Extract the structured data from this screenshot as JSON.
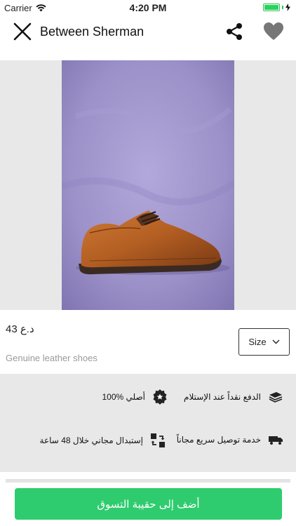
{
  "status_bar": {
    "carrier": "Carrier",
    "time": "4:20 PM"
  },
  "nav": {
    "title": "Between Sherman",
    "icons": [
      "close-icon",
      "share-icon",
      "heart-icon"
    ]
  },
  "product": {
    "price": "43 د.ع",
    "size_label": "Size",
    "description": "Genuine leather shoes"
  },
  "features": {
    "cash_on_delivery": "الدفع نقداً عند الإستلام",
    "original": "100% أصلي",
    "fast_delivery": "خدمة توصيل سريع مجاناً",
    "free_exchange": "إستبدال مجاني خلال 48 ساعة"
  },
  "actions": {
    "add_to_bag": "أضف إلى حقيبة التسوق"
  },
  "colors": {
    "accent_green": "#2fcc6f",
    "battery_green": "#2bd25c",
    "image_background": "#9e93c7",
    "panel_gray": "#e8e8e8"
  }
}
